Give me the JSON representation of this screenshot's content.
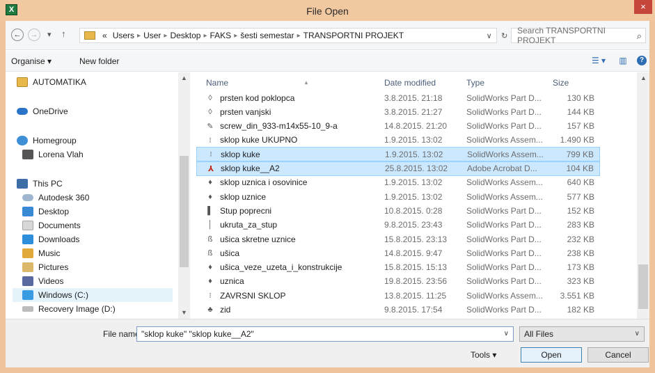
{
  "window": {
    "title": "File Open",
    "app_icon": "X",
    "close": "×"
  },
  "address": {
    "back": "←",
    "forward": "→",
    "recent": "▾",
    "up": "↑",
    "prefix": "«",
    "crumbs": [
      "Users",
      "User",
      "Desktop",
      "FAKS",
      "šesti semestar",
      "TRANSPORTNI PROJEKT"
    ],
    "crumb_sep": "▸",
    "dropdown": "∨",
    "refresh": "↻",
    "search_placeholder": "Search TRANSPORTNI PROJEKT",
    "search_icon": "⌕"
  },
  "toolbar": {
    "organise": "Organise ▾",
    "new_folder": "New folder",
    "views_icon": "☰ ▾",
    "preview_icon": "▥",
    "help_icon": "?"
  },
  "nav": {
    "items": [
      {
        "label": "AUTOMATIKA",
        "icon": "folder-icon"
      },
      {
        "label": "OneDrive",
        "icon": "cloud-icon"
      },
      {
        "label": "Homegroup",
        "icon": "homegroup-icon"
      },
      {
        "label": "Lorena Vlah",
        "icon": "user-icon"
      },
      {
        "label": "This PC",
        "icon": "computer-icon"
      },
      {
        "label": "Autodesk 360",
        "icon": "cloud-icon"
      },
      {
        "label": "Desktop",
        "icon": "desktop-icon"
      },
      {
        "label": "Documents",
        "icon": "documents-icon"
      },
      {
        "label": "Downloads",
        "icon": "downloads-icon"
      },
      {
        "label": "Music",
        "icon": "music-icon"
      },
      {
        "label": "Pictures",
        "icon": "pictures-icon"
      },
      {
        "label": "Videos",
        "icon": "videos-icon"
      },
      {
        "label": "Windows (C:)",
        "icon": "drive-icon"
      },
      {
        "label": "Recovery Image (D:)",
        "icon": "drive-icon"
      }
    ],
    "scroll_up": "▲",
    "scroll_down": "▼"
  },
  "files": {
    "headers": {
      "name": "Name",
      "date": "Date modified",
      "type": "Type",
      "size": "Size",
      "sort": "▲"
    },
    "rows": [
      {
        "name": "prsten kod poklopca",
        "date": "3.8.2015. 21:18",
        "type": "SolidWorks Part D...",
        "size": "130 KB",
        "icon": "part-icon",
        "glyph": "◊"
      },
      {
        "name": "prsten vanjski",
        "date": "3.8.2015. 21:27",
        "type": "SolidWorks Part D...",
        "size": "144 KB",
        "icon": "part-icon",
        "glyph": "◊"
      },
      {
        "name": "screw_din_933-m14x55-10_9-a",
        "date": "14.8.2015. 21:20",
        "type": "SolidWorks Part D...",
        "size": "157 KB",
        "icon": "part-icon",
        "glyph": "✎"
      },
      {
        "name": "sklop kuke UKUPNO",
        "date": "1.9.2015. 13:02",
        "type": "SolidWorks Assem...",
        "size": "1.490 KB",
        "icon": "assembly-icon",
        "glyph": "⁝"
      },
      {
        "name": "sklop kuke",
        "date": "1.9.2015. 13:02",
        "type": "SolidWorks Assem...",
        "size": "799 KB",
        "icon": "assembly-icon",
        "glyph": "⁝",
        "selected": true
      },
      {
        "name": "sklop kuke__A2",
        "date": "25.8.2015. 13:02",
        "type": "Adobe Acrobat D...",
        "size": "104 KB",
        "icon": "pdf-icon",
        "glyph": "⅄",
        "selected": true,
        "pdf": true
      },
      {
        "name": "sklop uznica i osovinice",
        "date": "1.9.2015. 13:02",
        "type": "SolidWorks Assem...",
        "size": "640 KB",
        "icon": "assembly-icon",
        "glyph": "♦"
      },
      {
        "name": "sklop uznice",
        "date": "1.9.2015. 13:02",
        "type": "SolidWorks Assem...",
        "size": "577 KB",
        "icon": "assembly-icon",
        "glyph": "♦"
      },
      {
        "name": "Stup poprecni",
        "date": "10.8.2015. 0:28",
        "type": "SolidWorks Part D...",
        "size": "152 KB",
        "icon": "part-icon",
        "glyph": "▌"
      },
      {
        "name": "ukruta_za_stup",
        "date": "9.8.2015. 23:43",
        "type": "SolidWorks Part D...",
        "size": "283 KB",
        "icon": "part-icon",
        "glyph": "│"
      },
      {
        "name": "ušica skretne uznice",
        "date": "15.8.2015. 23:13",
        "type": "SolidWorks Part D...",
        "size": "232 KB",
        "icon": "part-icon",
        "glyph": "ß"
      },
      {
        "name": "ušica",
        "date": "14.8.2015. 9:47",
        "type": "SolidWorks Part D...",
        "size": "238 KB",
        "icon": "part-icon",
        "glyph": "ß"
      },
      {
        "name": "ušica_veze_uzeta_i_konstrukcije",
        "date": "15.8.2015. 15:13",
        "type": "SolidWorks Part D...",
        "size": "173 KB",
        "icon": "part-icon",
        "glyph": "♦"
      },
      {
        "name": "uznica",
        "date": "19.8.2015. 23:56",
        "type": "SolidWorks Part D...",
        "size": "323 KB",
        "icon": "part-icon",
        "glyph": "♦"
      },
      {
        "name": "ZAVRSNI SKLOP",
        "date": "13.8.2015. 11:25",
        "type": "SolidWorks Assem...",
        "size": "3.551 KB",
        "icon": "assembly-icon",
        "glyph": "⁝"
      },
      {
        "name": "zid",
        "date": "9.8.2015. 17:54",
        "type": "SolidWorks Part D...",
        "size": "182 KB",
        "icon": "part-icon",
        "glyph": "♣"
      }
    ],
    "scroll_up": "▲"
  },
  "bottom": {
    "file_name_label": "File name:",
    "file_name_value": "\"sklop kuke\" \"sklop kuke__A2\"",
    "file_name_drop": "∨",
    "filter": "All Files",
    "filter_drop": "∨",
    "tools": "Tools  ▾",
    "open": "Open",
    "cancel": "Cancel"
  },
  "colors": {
    "title_bar": "#f2c8a1",
    "selection": "#cce8ff",
    "close": "#c7463c"
  }
}
